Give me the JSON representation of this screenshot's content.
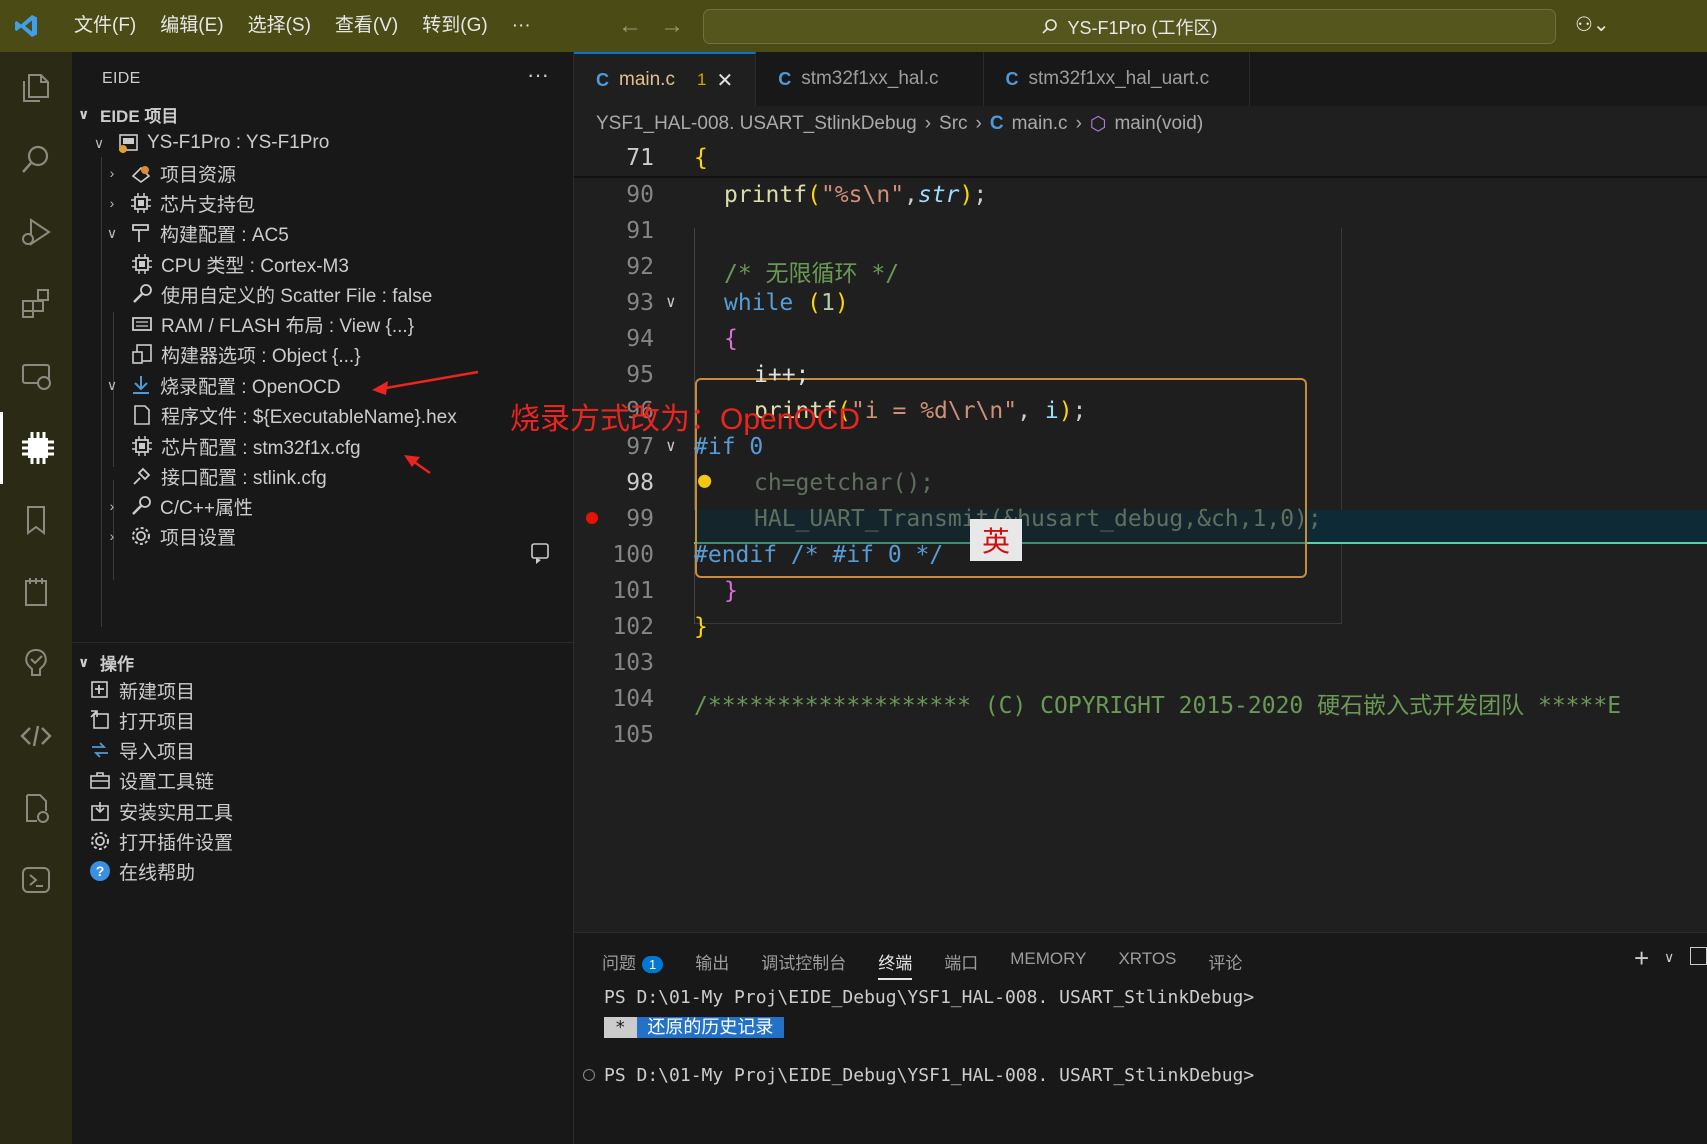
{
  "menu": [
    "文件(F)",
    "编辑(E)",
    "选择(S)",
    "查看(V)",
    "转到(G)",
    "···"
  ],
  "command_center": "YS-F1Pro (工作区)",
  "sidebar": {
    "header": "EIDE",
    "project_section": "EIDE 项目",
    "project_root": "YS-F1Pro : YS-F1Pro",
    "items": [
      "项目资源",
      "芯片支持包",
      "构建配置 : AC5",
      "CPU 类型 : Cortex-M3",
      "使用自定义的 Scatter File : false",
      "RAM / FLASH 布局 : View {...}",
      "构建器选项 : Object {...}",
      "烧录配置 : OpenOCD",
      "程序文件 : ${ExecutableName}.hex",
      "芯片配置 : stm32f1x.cfg",
      "接口配置 : stlink.cfg",
      "C/C++属性",
      "项目设置"
    ],
    "ops_section": "操作",
    "ops": [
      "新建项目",
      "打开项目",
      "导入项目",
      "设置工具链",
      "安装实用工具",
      "打开插件设置",
      "在线帮助"
    ]
  },
  "annotation": "烧录方式改为：OpenOCD",
  "tabs": [
    {
      "label": "main.c",
      "problems": "1"
    },
    {
      "label": "stm32f1xx_hal.c"
    },
    {
      "label": "stm32f1xx_hal_uart.c"
    }
  ],
  "breadcrumb": [
    "YSF1_HAL-008. USART_StlinkDebug",
    "Src",
    "main.c",
    "main(void)"
  ],
  "code": {
    "sticky": {
      "ln": "71",
      "text": "{"
    },
    "lines": [
      {
        "ln": "90",
        "t": "printf"
      },
      {
        "ln": "91",
        "t": ""
      },
      {
        "ln": "92",
        "t": "/* 无限循环 */"
      },
      {
        "ln": "93",
        "t": "while (1)"
      },
      {
        "ln": "94",
        "t": "{"
      },
      {
        "ln": "95",
        "t": "i++;"
      },
      {
        "ln": "96",
        "t": "printf"
      },
      {
        "ln": "97",
        "t": "#if 0"
      },
      {
        "ln": "98",
        "t": "ch=getchar();"
      },
      {
        "ln": "99",
        "t": "HAL_UART_Transmit(&husart_debug,&ch,1,0);"
      },
      {
        "ln": "100",
        "t": "#endif /* #if 0 */"
      },
      {
        "ln": "101",
        "t": "}"
      },
      {
        "ln": "102",
        "t": "}"
      },
      {
        "ln": "103",
        "t": ""
      },
      {
        "ln": "104",
        "t": "/******************* (C) COPYRIGHT 2015-2020 硬石嵌入式开发团队 *****E"
      },
      {
        "ln": "105",
        "t": ""
      }
    ]
  },
  "ime_label": "英",
  "panel": {
    "tabs": [
      "问题",
      "输出",
      "调试控制台",
      "终端",
      "端口",
      "MEMORY",
      "XRTOS",
      "评论"
    ],
    "problems_count": "1",
    "prompt1": "PS D:\\01-My Proj\\EIDE_Debug\\YSF1_HAL-008. USART_StlinkDebug>",
    "restore_star": " * ",
    "restore_text": " 还原的历史记录 ",
    "prompt2": "PS D:\\01-My Proj\\EIDE_Debug\\YSF1_HAL-008. USART_StlinkDebug>"
  }
}
